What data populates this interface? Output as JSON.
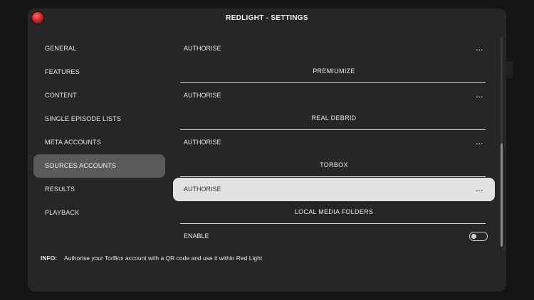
{
  "dialog": {
    "title": "REDLIGHT - SETTINGS"
  },
  "sidebar": {
    "items": [
      {
        "label": "GENERAL",
        "active": false
      },
      {
        "label": "FEATURES",
        "active": false
      },
      {
        "label": "CONTENT",
        "active": false
      },
      {
        "label": "SINGLE EPISODE LISTS",
        "active": false
      },
      {
        "label": "META ACCOUNTS",
        "active": false
      },
      {
        "label": "SOURCES ACCOUNTS",
        "active": true
      },
      {
        "label": "RESULTS",
        "active": false
      },
      {
        "label": "PLAYBACK",
        "active": false
      }
    ]
  },
  "settings": {
    "rows": [
      {
        "label": "AUTHORISE",
        "value": "...",
        "focused": false
      },
      {
        "header": "PREMIUMIZE"
      },
      {
        "label": "AUTHORISE",
        "value": "...",
        "focused": false
      },
      {
        "header": "REAL DEBRID"
      },
      {
        "label": "AUTHORISE",
        "value": "...",
        "focused": false
      },
      {
        "header": "TORBOX"
      },
      {
        "label": "AUTHORISE",
        "value": "...",
        "focused": true
      },
      {
        "header": "LOCAL MEDIA FOLDERS"
      },
      {
        "label": "ENABLE",
        "toggle": "off"
      }
    ]
  },
  "info": {
    "label": "INFO:",
    "text": "Authorise your TorBox account with a QR code and use it within Red Light"
  }
}
